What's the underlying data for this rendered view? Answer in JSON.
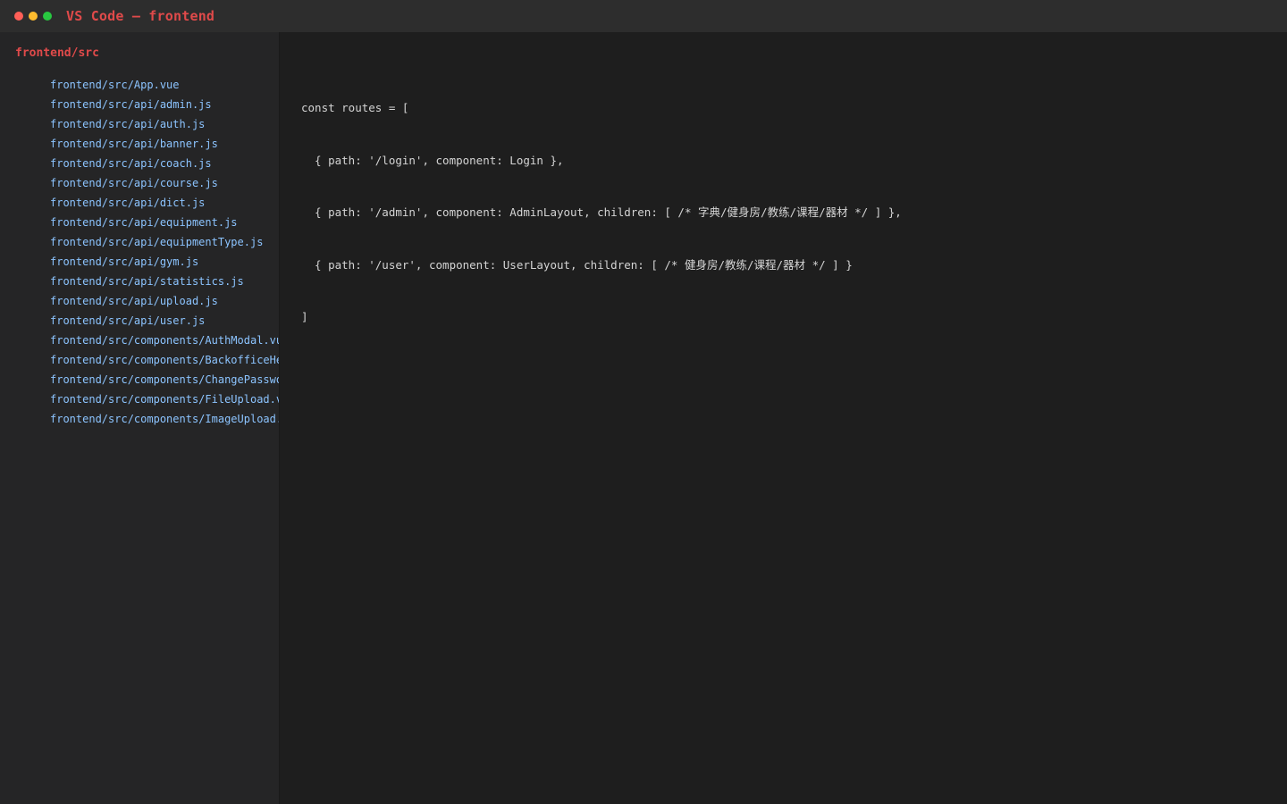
{
  "window": {
    "title": "VS Code — frontend",
    "controls": [
      {
        "name": "close",
        "color": "#ff5f57"
      },
      {
        "name": "minimize",
        "color": "#febc2e"
      },
      {
        "name": "maximize",
        "color": "#28c840"
      }
    ]
  },
  "sidebar": {
    "header": "frontend/src",
    "files": [
      "frontend/src/App.vue",
      "frontend/src/api/admin.js",
      "frontend/src/api/auth.js",
      "frontend/src/api/banner.js",
      "frontend/src/api/coach.js",
      "frontend/src/api/course.js",
      "frontend/src/api/dict.js",
      "frontend/src/api/equipment.js",
      "frontend/src/api/equipmentType.js",
      "frontend/src/api/gym.js",
      "frontend/src/api/statistics.js",
      "frontend/src/api/upload.js",
      "frontend/src/api/user.js",
      "frontend/src/components/AuthModal.vue",
      "frontend/src/components/BackofficeHeader.vue",
      "frontend/src/components/ChangePassword.vue",
      "frontend/src/components/FileUpload.vue",
      "frontend/src/components/ImageUpload.vue"
    ]
  },
  "editor": {
    "lines": [
      "const routes = [",
      "  { path: '/login', component: Login },",
      "  { path: '/admin', component: AdminLayout, children: [ /* 字典/健身房/教练/课程/器材 */ ] },",
      "  { path: '/user', component: UserLayout, children: [ /* 健身房/教练/课程/器材 */ ] }",
      "]"
    ]
  },
  "colors": {
    "accent": "#e04a4a",
    "file_link": "#8cc4ff",
    "code_text": "#d4d4d4",
    "editor_bg": "#1e1e1e",
    "sidebar_bg": "#252526",
    "titlebar_bg": "#2d2d2d"
  }
}
